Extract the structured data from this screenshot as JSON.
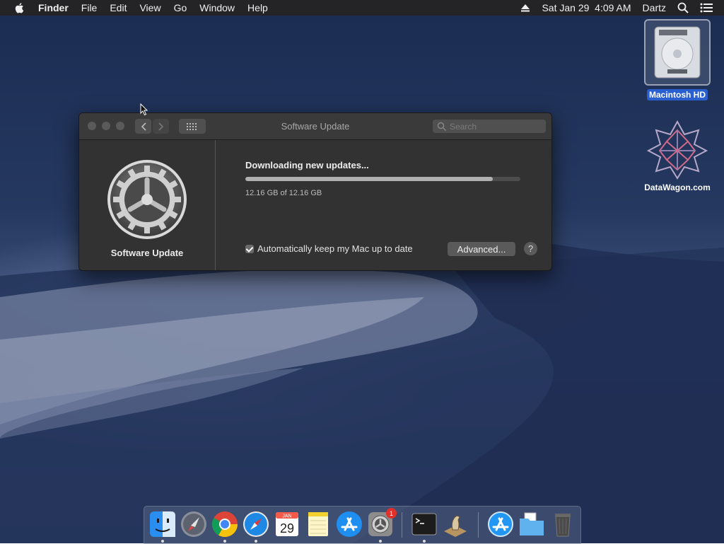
{
  "menubar": {
    "app_name": "Finder",
    "items": [
      "File",
      "Edit",
      "View",
      "Go",
      "Window",
      "Help"
    ],
    "datetime": "Sat Jan 29  4:09 AM",
    "user": "Dartz"
  },
  "desktop": {
    "icons": [
      {
        "label": "Macintosh HD",
        "icon": "hard-drive-icon",
        "selected": true
      },
      {
        "label": "DataWagon.com",
        "icon": "datawagon-logo-icon",
        "selected": false
      }
    ]
  },
  "window": {
    "title": "Software Update",
    "search_placeholder": "Search",
    "pane_name": "Software Update",
    "status_text": "Downloading new updates...",
    "progress_fraction": 0.9,
    "size_text": "12.16 GB of 12.16 GB",
    "auto_update_label": "Automatically keep my Mac up to date",
    "auto_update_checked": true,
    "advanced_button": "Advanced...",
    "help_button": "?"
  },
  "dock": {
    "items": [
      {
        "name": "Finder",
        "icon": "finder-icon",
        "running": true
      },
      {
        "name": "Launchpad",
        "icon": "launchpad-icon",
        "running": false
      },
      {
        "name": "Google Chrome",
        "icon": "chrome-icon",
        "running": true
      },
      {
        "name": "Safari",
        "icon": "safari-icon",
        "running": true
      },
      {
        "name": "Calendar",
        "icon": "calendar-icon",
        "running": false,
        "month": "JAN",
        "day": "29"
      },
      {
        "name": "Notes",
        "icon": "notes-icon",
        "running": false
      },
      {
        "name": "App Store",
        "icon": "app-store-icon",
        "running": false
      },
      {
        "name": "System Preferences",
        "icon": "system-preferences-icon",
        "running": true,
        "badge": "1"
      },
      {
        "name": "Terminal",
        "icon": "terminal-icon",
        "running": true
      },
      {
        "name": "Chess",
        "icon": "chess-icon",
        "running": false
      },
      {
        "name": "App Store Downloads",
        "icon": "app-store-folder-icon",
        "running": false
      },
      {
        "name": "Documents",
        "icon": "folder-icon",
        "running": false
      },
      {
        "name": "Trash",
        "icon": "trash-icon",
        "running": false
      }
    ]
  },
  "colors": {
    "menubar_bg": "#242426",
    "window_bg": "#323232",
    "selection": "#2a5fcf",
    "badge": "#e0302a"
  }
}
